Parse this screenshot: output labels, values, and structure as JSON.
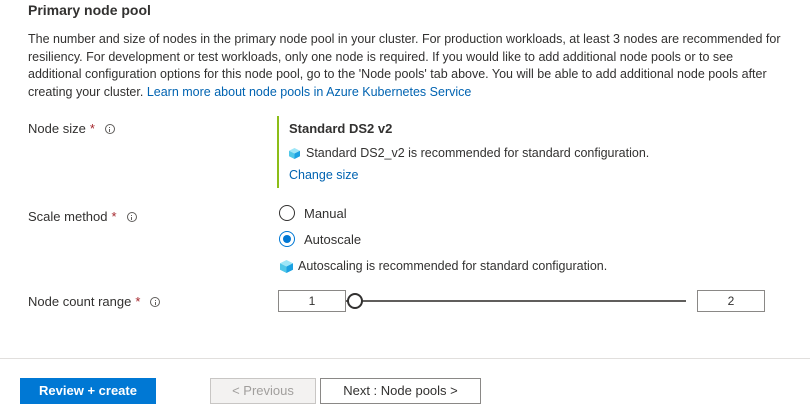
{
  "section": {
    "title": "Primary node pool",
    "description": "The number and size of nodes in the primary node pool in your cluster. For production workloads, at least 3 nodes are recommended for resiliency. For development or test workloads, only one node is required. If you would like to add additional node pools or to see additional configuration options for this node pool, go to the 'Node pools' tab above. You will be able to add additional node pools after creating your cluster.",
    "learn_more": "Learn more about node pools in Azure Kubernetes Service"
  },
  "node_size": {
    "label": "Node size",
    "required_mark": "*",
    "info_icon": "info-icon",
    "value": "Standard DS2 v2",
    "recommendation": "Standard DS2_v2 is recommended for standard configuration.",
    "change_link": "Change size"
  },
  "scale_method": {
    "label": "Scale method",
    "required_mark": "*",
    "options": [
      "Manual",
      "Autoscale"
    ],
    "selected": "Autoscale",
    "recommendation": "Autoscaling is recommended for standard configuration."
  },
  "node_count": {
    "label": "Node count range",
    "required_mark": "*",
    "min_value": "1",
    "max_value": "2"
  },
  "footer": {
    "review_create": "Review + create",
    "previous": "< Previous",
    "next": "Next : Node pools >"
  },
  "colors": {
    "accent": "#0078d4",
    "link": "#0063b1",
    "node_bar": "#8cbd18",
    "required": "#a4262c"
  }
}
